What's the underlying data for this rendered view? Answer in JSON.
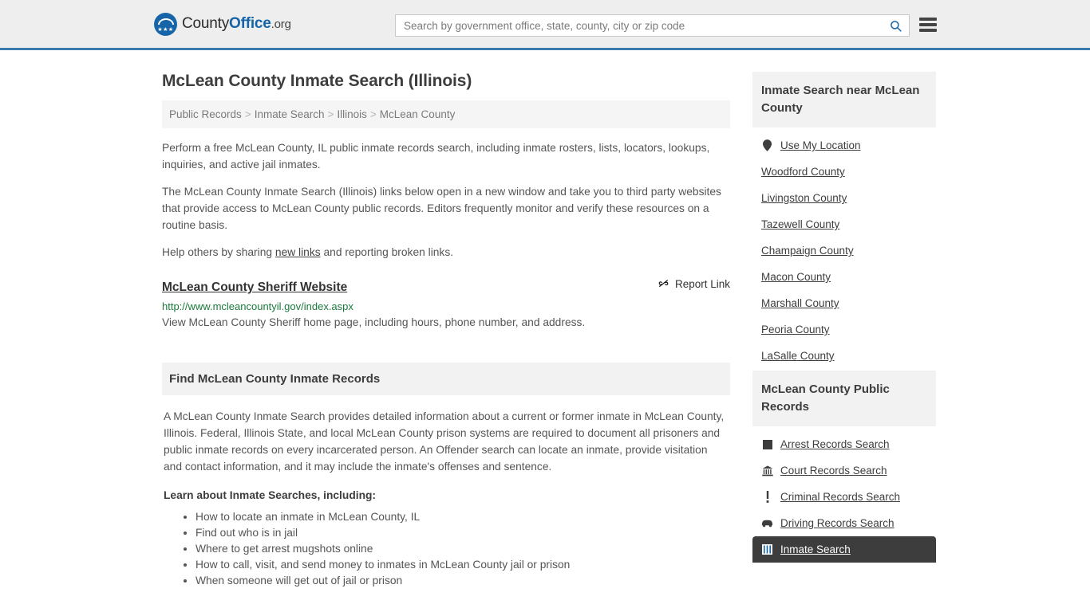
{
  "header": {
    "logo": {
      "name_part1": "County",
      "name_part2": "Office",
      "name_part3": ".org",
      "mark_icon": "eagle-shield-icon",
      "stars": "★★★"
    },
    "search": {
      "placeholder": "Search by government office, state, county, city or zip code",
      "value": "",
      "icon": "search-icon"
    },
    "menu_icon": "hamburger-menu-icon",
    "accent_color": "#3b7bb0"
  },
  "page": {
    "title": "McLean County Inmate Search (Illinois)"
  },
  "breadcrumb": {
    "separator": ">",
    "items": [
      {
        "label": "Public Records"
      },
      {
        "label": "Inmate Search"
      },
      {
        "label": "Illinois"
      },
      {
        "label": "McLean County"
      }
    ]
  },
  "intro": {
    "paragraph1": "Perform a free McLean County, IL public inmate records search, including inmate rosters, lists, locators, lookups, inquiries, and active jail inmates.",
    "paragraph2": "The McLean County Inmate Search (Illinois) links below open in a new window and take you to third party websites that provide access to McLean County public records. Editors frequently monitor and verify these resources on a routine basis.",
    "paragraph3_before": "Help others by sharing ",
    "paragraph3_link": "new links",
    "paragraph3_after": " and reporting broken links."
  },
  "result": {
    "title": "McLean County Sheriff Website",
    "report_label": "Report Link",
    "report_icon": "broken-link-icon",
    "url": "http://www.mcleancountyil.gov/index.aspx",
    "description": "View McLean County Sheriff home page, including hours, phone number, and address.",
    "url_color": "#1a7a3c"
  },
  "records_section": {
    "heading": "Find McLean County Inmate Records",
    "paragraph": "A McLean County Inmate Search provides detailed information about a current or former inmate in McLean County, Illinois. Federal, Illinois State, and local McLean County prison systems are required to document all prisoners and public inmate records on every incarcerated person. An Offender search can locate an inmate, provide visitation and contact information, and it may include the inmate's offenses and sentence.",
    "lead_in": "Learn about Inmate Searches, including:",
    "bullets": [
      "How to locate an inmate in McLean County, IL",
      "Find out who is in jail",
      "Where to get arrest mugshots online",
      "How to call, visit, and send money to inmates in McLean County jail or prison",
      "When someone will get out of jail or prison"
    ]
  },
  "sidebar": {
    "nearby": {
      "heading": "Inmate Search near McLean County",
      "items": [
        {
          "label": "Use My Location",
          "icon": "map-pin-icon"
        },
        {
          "label": "Woodford County",
          "icon": ""
        },
        {
          "label": "Livingston County",
          "icon": ""
        },
        {
          "label": "Tazewell County",
          "icon": ""
        },
        {
          "label": "Champaign County",
          "icon": ""
        },
        {
          "label": "Macon County",
          "icon": ""
        },
        {
          "label": "Marshall County",
          "icon": ""
        },
        {
          "label": "Peoria County",
          "icon": ""
        },
        {
          "label": "LaSalle County",
          "icon": ""
        }
      ]
    },
    "public_records": {
      "heading": "McLean County Public Records",
      "items": [
        {
          "label": "Arrest Records Search",
          "icon": "square-icon",
          "active": false
        },
        {
          "label": "Court Records Search",
          "icon": "courthouse-icon",
          "active": false
        },
        {
          "label": "Criminal Records Search",
          "icon": "exclamation-icon",
          "active": false
        },
        {
          "label": "Driving Records Search",
          "icon": "car-icon",
          "active": false
        },
        {
          "label": "Inmate Search",
          "icon": "jail-icon",
          "active": true
        }
      ],
      "active_bg": "#3d3d3d"
    }
  }
}
